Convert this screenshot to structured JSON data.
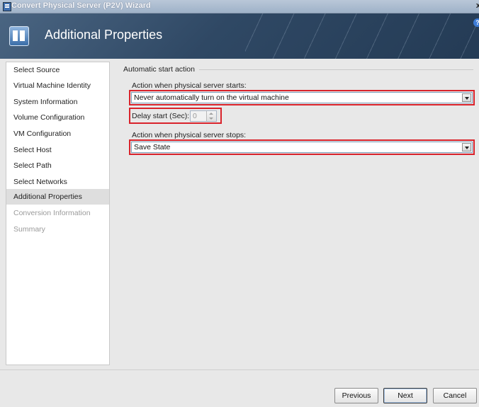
{
  "window": {
    "title": "Convert Physical Server (P2V) Wizard",
    "close_glyph": "x",
    "icon": "wizard-window-icon"
  },
  "banner": {
    "title": "Additional Properties",
    "icon": "properties-icon",
    "help_glyph": "?"
  },
  "sidebar": {
    "items": [
      {
        "label": "Select Source",
        "state": "normal"
      },
      {
        "label": "Virtual Machine Identity",
        "state": "normal"
      },
      {
        "label": "System Information",
        "state": "normal"
      },
      {
        "label": "Volume Configuration",
        "state": "normal"
      },
      {
        "label": "VM Configuration",
        "state": "normal"
      },
      {
        "label": "Select Host",
        "state": "normal"
      },
      {
        "label": "Select Path",
        "state": "normal"
      },
      {
        "label": "Select Networks",
        "state": "normal"
      },
      {
        "label": "Additional Properties",
        "state": "active"
      },
      {
        "label": "Conversion Information",
        "state": "disabled"
      },
      {
        "label": "Summary",
        "state": "disabled"
      }
    ]
  },
  "main": {
    "group_title": "Automatic start action",
    "start_label": "Action when physical server starts:",
    "start_value": "Never automatically turn on the virtual machine",
    "delay_label": "Delay start (Sec):",
    "delay_value": "0",
    "stop_label": "Action when physical server stops:",
    "stop_value": "Save State"
  },
  "footer": {
    "previous_label": "Previous",
    "next_label": "Next",
    "cancel_label": "Cancel"
  },
  "colors": {
    "highlight": "#d9232b",
    "banner": "#2f4864"
  }
}
